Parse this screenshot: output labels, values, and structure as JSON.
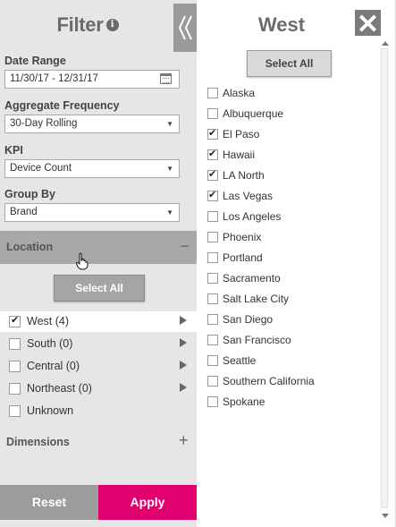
{
  "filter": {
    "title": "Filter",
    "info_icon": "info-icon",
    "collapse_icon": "double-chevron-left-icon",
    "date_range": {
      "label": "Date Range",
      "value": "11/30/17 - 12/31/17",
      "icon": "calendar-icon"
    },
    "aggregate_frequency": {
      "label": "Aggregate Frequency",
      "value": "30-Day Rolling"
    },
    "kpi": {
      "label": "KPI",
      "value": "Device Count"
    },
    "group_by": {
      "label": "Group By",
      "value": "Brand"
    },
    "location": {
      "label": "Location",
      "collapse_symbol": "−",
      "select_all": "Select All",
      "regions": [
        {
          "label": "West (4)",
          "checked": true,
          "active": true,
          "has_submenu": true
        },
        {
          "label": "South (0)",
          "checked": false,
          "active": false,
          "has_submenu": true
        },
        {
          "label": "Central (0)",
          "checked": false,
          "active": false,
          "has_submenu": true
        },
        {
          "label": "Northeast (0)",
          "checked": false,
          "active": false,
          "has_submenu": true
        },
        {
          "label": "Unknown",
          "checked": false,
          "active": false,
          "has_submenu": false
        }
      ]
    },
    "dimensions": {
      "label": "Dimensions",
      "add_symbol": "+"
    },
    "reset": "Reset",
    "apply": "Apply"
  },
  "west_panel": {
    "title": "West",
    "close_icon": "close-icon",
    "select_all": "Select All",
    "cities": [
      {
        "label": "Alaska",
        "checked": false
      },
      {
        "label": "Albuquerque",
        "checked": false
      },
      {
        "label": "El Paso",
        "checked": true
      },
      {
        "label": "Hawaii",
        "checked": true
      },
      {
        "label": "LA North",
        "checked": true
      },
      {
        "label": "Las Vegas",
        "checked": true
      },
      {
        "label": "Los Angeles",
        "checked": false
      },
      {
        "label": "Phoenix",
        "checked": false
      },
      {
        "label": "Portland",
        "checked": false
      },
      {
        "label": "Sacramento",
        "checked": false
      },
      {
        "label": "Salt Lake City",
        "checked": false
      },
      {
        "label": "San Diego",
        "checked": false
      },
      {
        "label": "San Francisco",
        "checked": false
      },
      {
        "label": "Seattle",
        "checked": false
      },
      {
        "label": "Southern California",
        "checked": false
      },
      {
        "label": "Spokane",
        "checked": false
      }
    ]
  },
  "colors": {
    "apply": "#e0006e",
    "panel": "#e6e6e6",
    "section_header": "#a8a8a8"
  }
}
